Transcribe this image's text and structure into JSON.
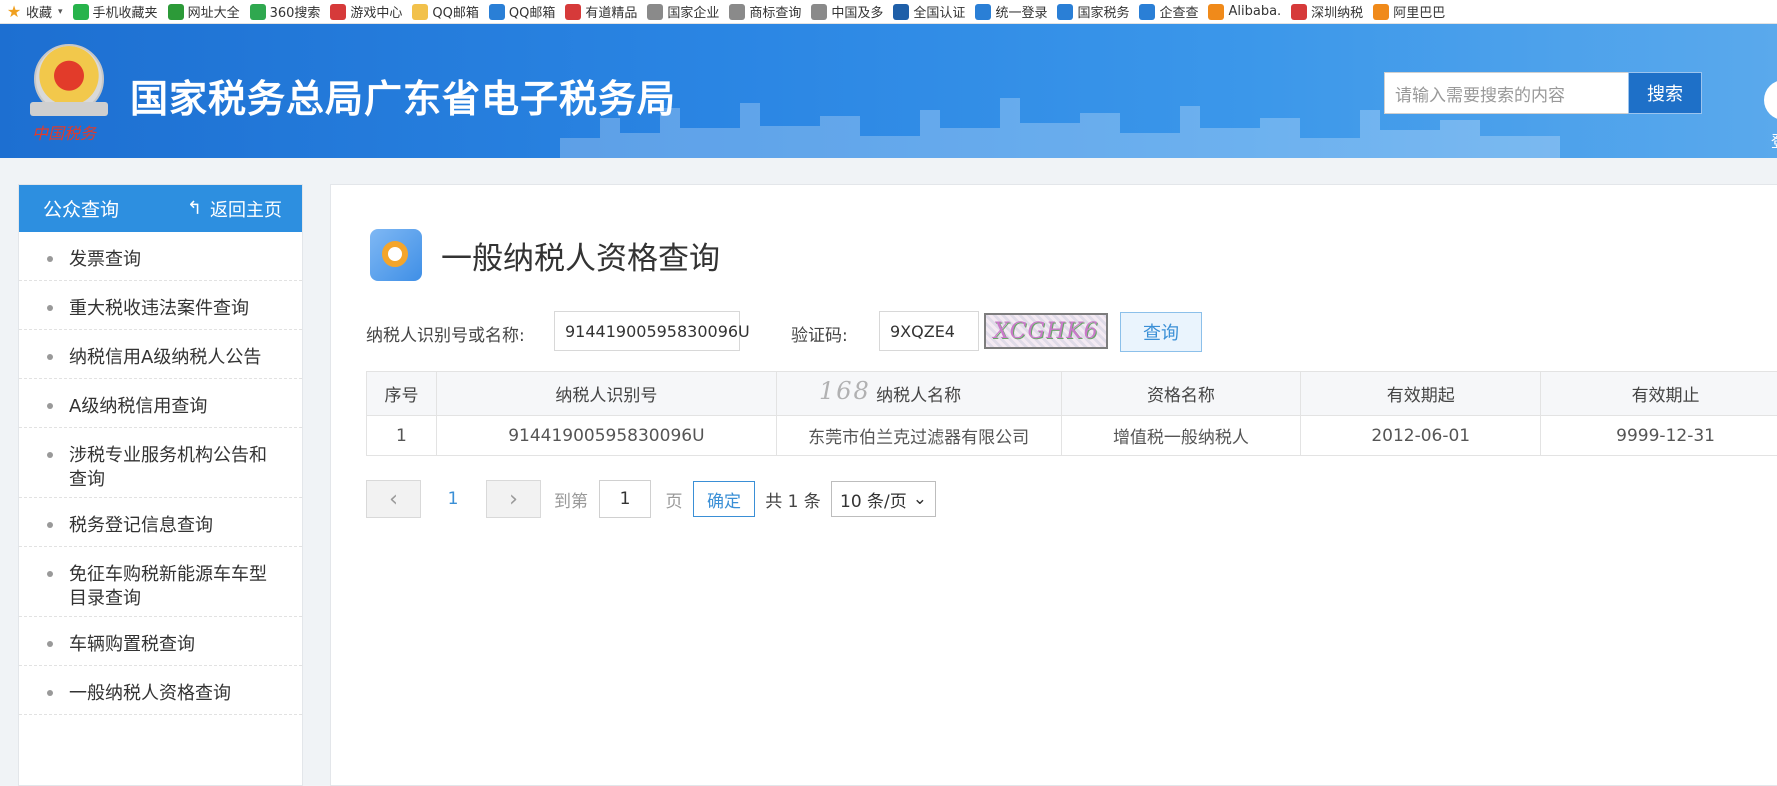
{
  "bookmarks": [
    {
      "label": "收藏",
      "icon": "star-icon",
      "color": "#f0a020"
    },
    {
      "label": "手机收藏夹",
      "icon": "phone-icon",
      "color": "#27b34b"
    },
    {
      "label": "网址大全",
      "icon": "plus-icon",
      "color": "#2c9a38"
    },
    {
      "label": "360搜索",
      "icon": "search-icon",
      "color": "#2fa84f"
    },
    {
      "label": "游戏中心",
      "icon": "game-icon",
      "color": "#d63a3a"
    },
    {
      "label": "QQ邮箱",
      "icon": "folder-icon",
      "color": "#f2c14b"
    },
    {
      "label": "QQ邮箱",
      "icon": "mail-icon",
      "color": "#2a7fd6"
    },
    {
      "label": "有道精品",
      "icon": "video-icon",
      "color": "#d63a3a"
    },
    {
      "label": "国家企业",
      "icon": "globe-icon",
      "color": "#8a8a8a"
    },
    {
      "label": "商标查询",
      "icon": "globe-icon",
      "color": "#8a8a8a"
    },
    {
      "label": "中国及多",
      "icon": "globe-icon",
      "color": "#8a8a8a"
    },
    {
      "label": "全国认证",
      "icon": "grid-icon",
      "color": "#1f5fa8"
    },
    {
      "label": "统一登录",
      "icon": "shield-icon",
      "color": "#2a7fd6"
    },
    {
      "label": "国家税务",
      "icon": "tax-icon",
      "color": "#2a7fd6"
    },
    {
      "label": "企查查",
      "icon": "qcc-icon",
      "color": "#2a7fd6"
    },
    {
      "label": "Alibaba.",
      "icon": "alibaba-icon",
      "color": "#f08a1a"
    },
    {
      "label": "深圳纳税",
      "icon": "emblem-icon",
      "color": "#d63a3a"
    },
    {
      "label": "阿里巴巴",
      "icon": "ali-icon",
      "color": "#f08a1a"
    }
  ],
  "header": {
    "title": "国家税务总局广东省电子税务局",
    "search_placeholder": "请输入需要搜索的内容",
    "search_button": "搜索",
    "login_partial": "登"
  },
  "sidebar": {
    "title": "公众查询",
    "back_label": "返回主页",
    "items": [
      "发票查询",
      "重大税收违法案件查询",
      "纳税信用A级纳税人公告",
      "A级纳税信用查询",
      "涉税专业服务机构公告和查询",
      "税务登记信息查询",
      "免征车购税新能源车车型目录查询",
      "车辆购置税查询",
      "一般纳税人资格查询"
    ]
  },
  "main": {
    "title": "一般纳税人资格查询",
    "taxpayer_label": "纳税人识别号或名称:",
    "taxpayer_value": "91441900595830096U",
    "captcha_label": "验证码:",
    "captcha_value": "9XQZE4",
    "captcha_image_text": "XCGHK6",
    "query_button": "查询",
    "watermark": "168"
  },
  "table": {
    "headers": [
      "序号",
      "纳税人识别号",
      "纳税人名称",
      "资格名称",
      "有效期起",
      "有效期止"
    ],
    "rows": [
      [
        "1",
        "91441900595830096U",
        "东莞市伯兰克过滤器有限公司",
        "增值税一般纳税人",
        "2012-06-01",
        "9999-12-31"
      ]
    ]
  },
  "pagination": {
    "prev": "‹",
    "current": "1",
    "next": "›",
    "goto_label": "到第",
    "goto_value": "1",
    "page_unit": "页",
    "confirm": "确定",
    "total": "共 1 条",
    "page_size": "10 条/页"
  },
  "colors": {
    "banner": "#2a85e3",
    "sidebar_head": "#2d8fe0",
    "accent": "#3a8fd6"
  }
}
